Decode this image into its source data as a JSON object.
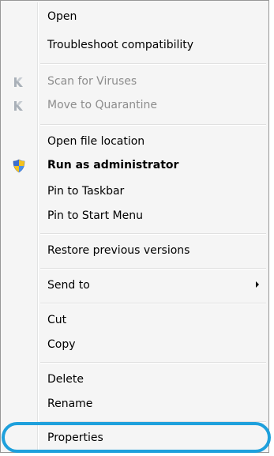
{
  "menu": {
    "items": {
      "open": "Open",
      "troubleshoot": "Troubleshoot compatibility",
      "scan": "Scan for Viruses",
      "quarantine": "Move to Quarantine",
      "open_location": "Open file location",
      "run_admin": "Run as administrator",
      "pin_taskbar": "Pin to Taskbar",
      "pin_start": "Pin to Start Menu",
      "restore": "Restore previous versions",
      "send_to": "Send to",
      "cut": "Cut",
      "copy": "Copy",
      "delete": "Delete",
      "rename": "Rename",
      "properties": "Properties"
    },
    "icons": {
      "scan": "kaspersky-k-icon",
      "quarantine": "kaspersky-k-icon",
      "run_admin": "uac-shield-icon",
      "send_to": "chevron-right-icon"
    },
    "colors": {
      "highlight_ring": "#1ea0dc",
      "disabled_text": "#8d8d8d"
    }
  }
}
